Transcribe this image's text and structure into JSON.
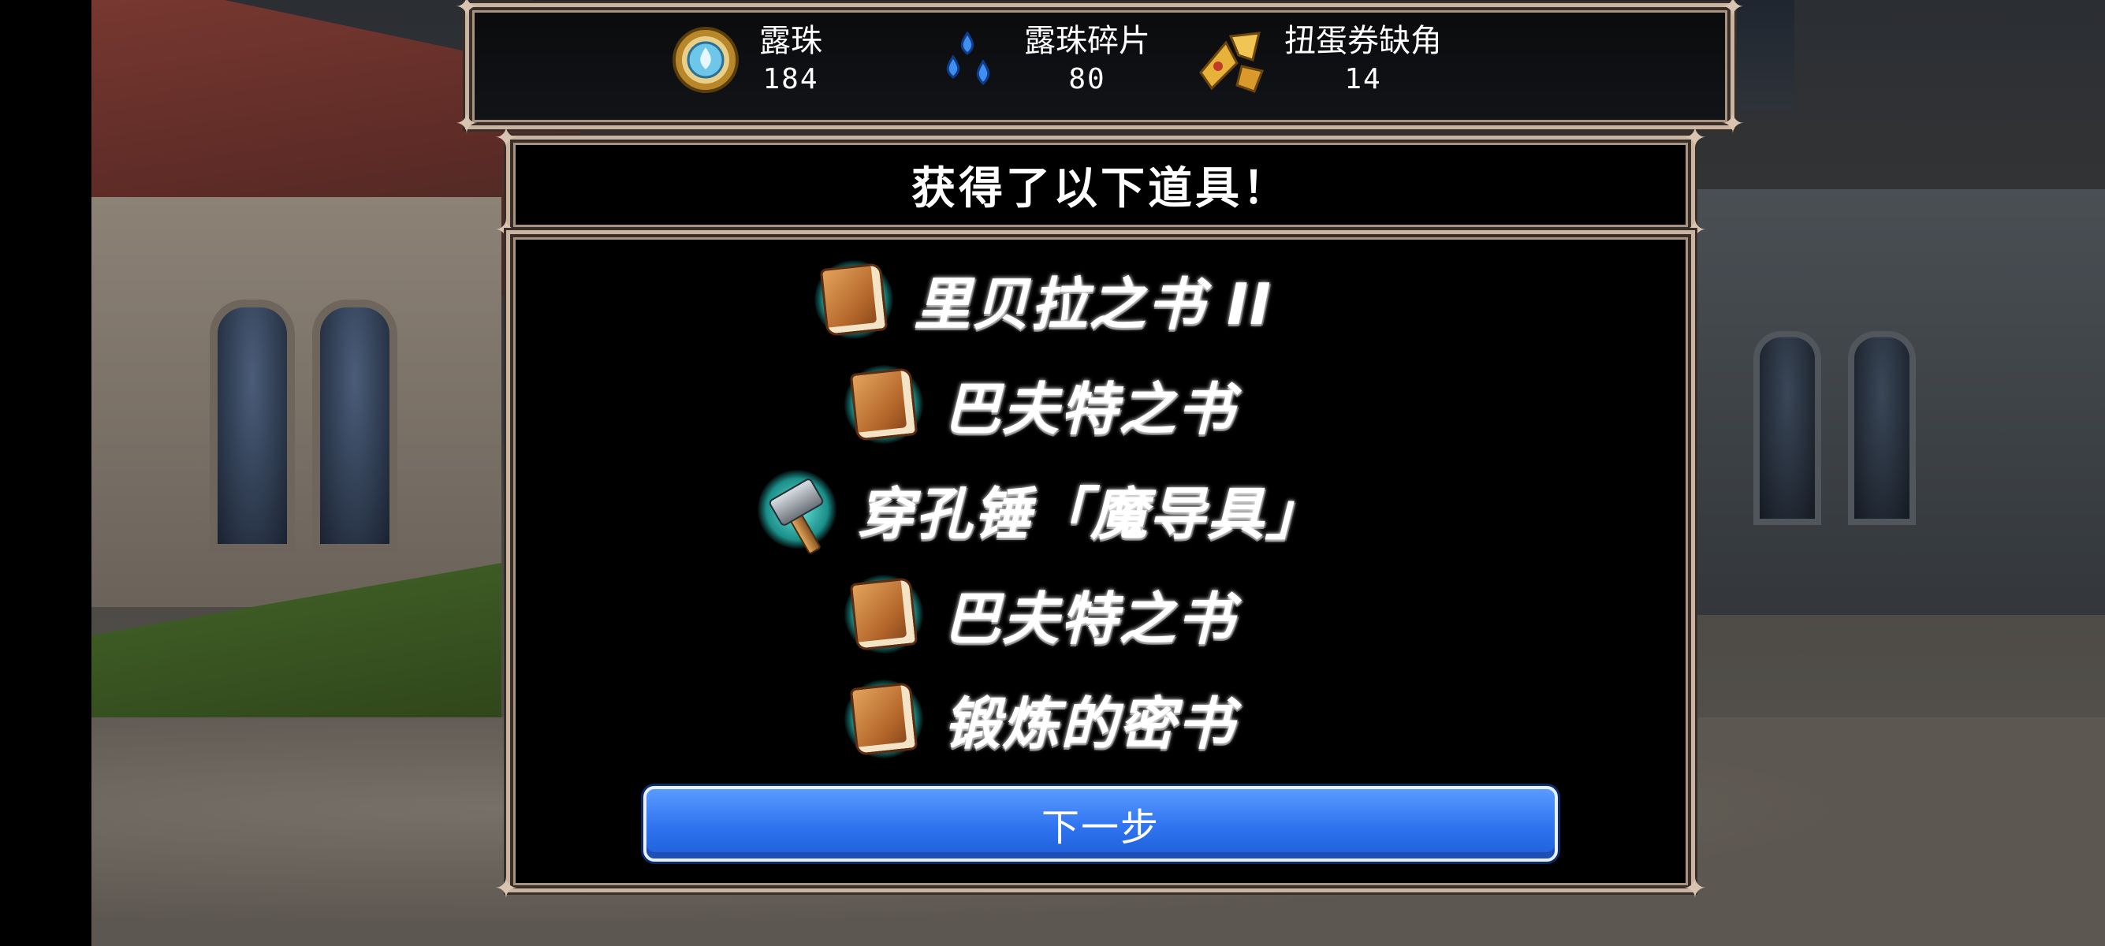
{
  "currencies": [
    {
      "name": "露珠",
      "value": "184",
      "icon": "dew-orb-icon"
    },
    {
      "name": "露珠碎片",
      "value": "80",
      "icon": "dew-shards-icon"
    },
    {
      "name": "扭蛋券缺角",
      "value": "14",
      "icon": "gacha-ticket-pieces-icon"
    }
  ],
  "dialog": {
    "title": "获得了以下道具！",
    "items": [
      {
        "name": "里贝拉之书 II",
        "icon": "book-icon"
      },
      {
        "name": "巴夫特之书",
        "icon": "book-icon"
      },
      {
        "name": "穿孔锤「魔导具」",
        "icon": "hammer-icon"
      },
      {
        "name": "巴夫特之书",
        "icon": "book-icon"
      },
      {
        "name": "锻炼的密书",
        "icon": "book-icon"
      }
    ],
    "next_label": "下一步"
  },
  "colors": {
    "frame": "#c9b4a1",
    "button": "#2f73f0",
    "item_glow": "#6fe8e0"
  }
}
